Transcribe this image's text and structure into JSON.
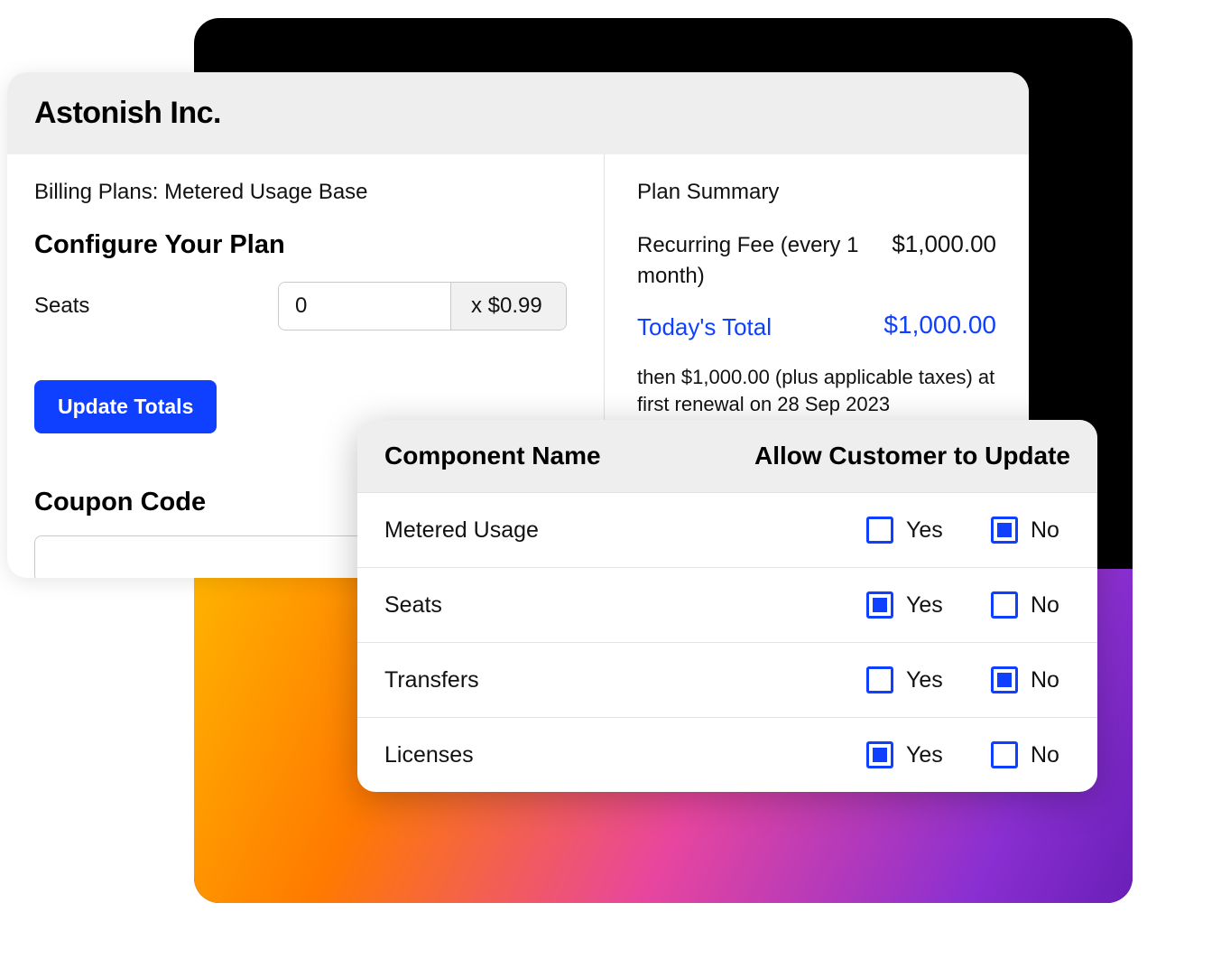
{
  "company": "Astonish Inc.",
  "billing_line": "Billing Plans: Metered Usage Base",
  "configure_title": "Configure Your Plan",
  "seats": {
    "label": "Seats",
    "value": "0",
    "unit_price": "x $0.99"
  },
  "update_button": "Update Totals",
  "coupon": {
    "title": "Coupon Code",
    "value": ""
  },
  "summary": {
    "title": "Plan Summary",
    "recurring": {
      "label": "Recurring Fee (every 1 month)",
      "value": "$1,000.00"
    },
    "today_total": {
      "label": "Today's Total",
      "value": "$1,000.00"
    },
    "renewal_note": "then $1,000.00 (plus applicable taxes) at first renewal on 28 Sep 2023"
  },
  "component_table": {
    "header_name": "Component Name",
    "header_allow": "Allow Customer to Update",
    "yes_label": "Yes",
    "no_label": "No",
    "rows": [
      {
        "name": "Metered Usage",
        "yes": false,
        "no": true
      },
      {
        "name": "Seats",
        "yes": true,
        "no": false
      },
      {
        "name": "Transfers",
        "yes": false,
        "no": true
      },
      {
        "name": "Licenses",
        "yes": true,
        "no": false
      }
    ]
  }
}
